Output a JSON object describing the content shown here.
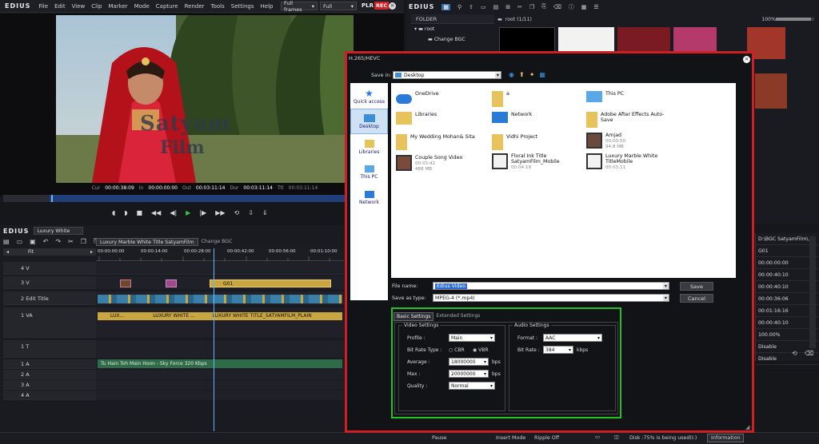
{
  "app": {
    "logo": "EDIUS",
    "logo2": "EDIUS",
    "logo3": "EDIUS"
  },
  "menu": [
    "File",
    "Edit",
    "View",
    "Clip",
    "Marker",
    "Mode",
    "Capture",
    "Render",
    "Tools",
    "Settings",
    "Help"
  ],
  "preview": {
    "frames_select": "Full frames",
    "zoom_select": "Full",
    "plr_label": "PLR",
    "rec_label": "REC",
    "watermark_line1": "Satyam",
    "watermark_line2": "Film",
    "cur_label": "Cur",
    "cur": "00:00:38:09",
    "in_label": "In",
    "in": "00:00:00:00",
    "out_label": "Out",
    "out": "00:03:11:14",
    "dur_label": "Dur",
    "dur": "00:03:11:14",
    "ttl_label": "Ttl",
    "ttl": "00:03:11:14"
  },
  "bin": {
    "folder_header": "FOLDER",
    "root_folder": "root",
    "sub_folder": "Change BGC",
    "path": "root (1/11)",
    "zoom": "100%"
  },
  "timeline": {
    "project_name": "Luxury White",
    "tabs": [
      "Luxury Marble White Title SatyamFilm",
      "Change BGC"
    ],
    "fit": "Fit",
    "ruler": [
      "00:00:00:00",
      "00:00:14:00",
      "00:00:28:00",
      "00:00:42:00",
      "00:00:56:00",
      "00:01:10:00"
    ],
    "tracks": [
      {
        "name": "4 V"
      },
      {
        "name": "3 V"
      },
      {
        "name": "2 Edit Title"
      },
      {
        "name": "1 VA"
      },
      {
        "name": "1 T"
      },
      {
        "name": "1 A"
      },
      {
        "name": "2 A"
      },
      {
        "name": "3 A"
      },
      {
        "name": "4 A"
      }
    ],
    "clip_g01": "G01",
    "clip_va1": "LUX...",
    "clip_va2": "LUXURY WHITE ...",
    "clip_va3": "LUXURY WHITE TITLE_SATYAMFILM_PLAIN",
    "clip_audio": "Tu Hain Toh Main Hoon - Sky Force 320 Kbps"
  },
  "properties": {
    "path": "D:\\BGC SatyamFilm\\...",
    "rows": [
      "G01",
      "00:00:00:00",
      "00:00:40:10",
      "00:00:40:10",
      "00:00:36:06",
      "00:01:16:16",
      "00:00:40:10",
      "100.00%",
      "Disable",
      "Disable"
    ]
  },
  "status": {
    "pause": "Pause",
    "insert_mode": "Insert Mode",
    "ripple": "Ripple Off",
    "disk": "Disk :75% is being used(I:)",
    "info_button": "Information"
  },
  "dialog": {
    "title": "H.265/HEVC",
    "save_in_label": "Save in:",
    "save_in_value": "Desktop",
    "places": [
      "Quick access",
      "Desktop",
      "Libraries",
      "This PC",
      "Network"
    ],
    "files": [
      {
        "name": "OneDrive",
        "sub": ""
      },
      {
        "name": "a",
        "sub": ""
      },
      {
        "name": "This PC",
        "sub": ""
      },
      {
        "name": "Libraries",
        "sub": ""
      },
      {
        "name": "Network",
        "sub": ""
      },
      {
        "name": "Adobe After Effects Auto-Save",
        "sub": ""
      },
      {
        "name": "My Wedding Mohan& Sita",
        "sub": ""
      },
      {
        "name": "Vidhi Project",
        "sub": ""
      },
      {
        "name": "Amjad",
        "sub": "00:00:50",
        "sub2": "94.8 MB"
      },
      {
        "name": "Couple Song Video",
        "sub": "00:03:42",
        "sub2": "488 MB"
      },
      {
        "name": "Floral Ink Title SatyamFilm_Mobile",
        "sub": "00:04:19"
      },
      {
        "name": "Luxury Marble White TitleMobile",
        "sub": "00:03:11"
      }
    ],
    "file_name_label": "File name:",
    "file_name_value": "Edius Video",
    "save_type_label": "Save as type:",
    "save_type_value": "MPEG-4 (*.mp4)",
    "save_button": "Save",
    "cancel_button": "Cancel",
    "tabs": [
      "Basic Settings",
      "Extended Settings"
    ],
    "video_settings": "Video Settings",
    "audio_settings": "Audio Settings",
    "profile_label": "Profile :",
    "profile_value": "Main",
    "bitrate_type_label": "Bit Rate Type :",
    "cbr": "CBR",
    "vbr": "VBR",
    "average_label": "Average :",
    "average_value": "18000000",
    "average_unit": "bps",
    "max_label": "Max :",
    "max_value": "20000000",
    "max_unit": "bps",
    "quality_label": "Quality :",
    "quality_value": "Normal",
    "format_label": "Format :",
    "format_value": "AAC",
    "abitrate_label": "Bit Rate :",
    "abitrate_value": "384",
    "abitrate_unit": "kbps"
  },
  "colors": {
    "rec": "#d11d24",
    "highlight_green": "#22c12a",
    "dialog_border": "#d11d24",
    "clip_blue": "#3a6fa8",
    "clip_gold": "#c9a640",
    "audio_green": "#2f6b48"
  }
}
